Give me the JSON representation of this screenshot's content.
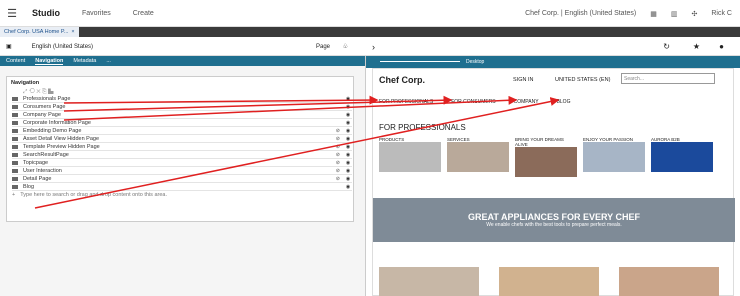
{
  "topbar": {
    "menu_icon": "menu-icon",
    "app_title": "Studio",
    "favorites": "Favorites",
    "create": "Create",
    "site_selector": "Chef Corp. | English (United States)",
    "user": "Rick C"
  },
  "tab": {
    "label": "Chef Corp. USA Home P...",
    "close": "×"
  },
  "leftbar": {
    "locale": "English (United States)",
    "page_type": "Page"
  },
  "subtabs": [
    "Content",
    "Navigation",
    "Metadata",
    "..."
  ],
  "navigation": {
    "header": "Navigation",
    "rows": [
      "Professionals Page",
      "Consumers Page",
      "Company Page",
      "Corporate Information Page",
      "Embedding Demo Page",
      "Asset Detail View Hidden Page",
      "Template Preview Hidden Page",
      "SearchResultPage",
      "Topicpage",
      "User Interaction",
      "Detail Page",
      "Blog"
    ],
    "drop_hint": "Type here to search or drag and drop content onto this area."
  },
  "preview": {
    "device": "Desktop",
    "logo": "Chef Corp.",
    "sign_in": "SIGN IN",
    "region": "UNITED STATES (EN)",
    "search_placeholder": "Search...",
    "nav": [
      "FOR PROFESSIONALS",
      "FOR CONSUMERS",
      "COMPANY",
      "BLOG"
    ],
    "section_title": "FOR PROFESSIONALS",
    "cards": [
      "PRODUCTS",
      "SERVICES",
      "BRING YOUR DREAMS ALIVE",
      "ENJOY YOUR PASSION",
      "AURORA B2B"
    ],
    "banner_title": "GREAT APPLIANCES FOR EVERY CHEF",
    "banner_subtitle": "We enable chefs with the best tools to prepare perfect meals."
  },
  "colors": {
    "accent": "#1f6f8f",
    "arrow": "#e02020",
    "dark_strip": "#3a3a3a"
  }
}
